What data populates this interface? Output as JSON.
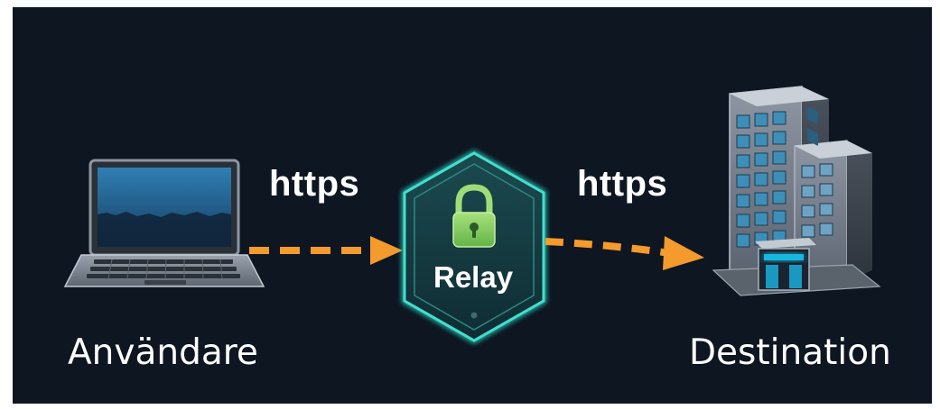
{
  "nodes": {
    "user": {
      "label": "Användare"
    },
    "relay": {
      "label": "Relay"
    },
    "destination": {
      "label": "Destination"
    }
  },
  "edges": [
    {
      "from": "user",
      "to": "relay",
      "protocol": "https",
      "style": "dashed",
      "color": "#f59a2c"
    },
    {
      "from": "relay",
      "to": "destination",
      "protocol": "https",
      "style": "dashed",
      "color": "#f59a2c"
    }
  ],
  "colors": {
    "background": "#0d1621",
    "accent_arrow": "#f59a2c",
    "relay_glow": "#2fd0c0",
    "lock": "#8fd46a",
    "building_glow": "#19b8e0"
  },
  "icons": {
    "user": "laptop-icon",
    "relay": "padlock-shield-icon",
    "destination": "office-building-icon"
  }
}
